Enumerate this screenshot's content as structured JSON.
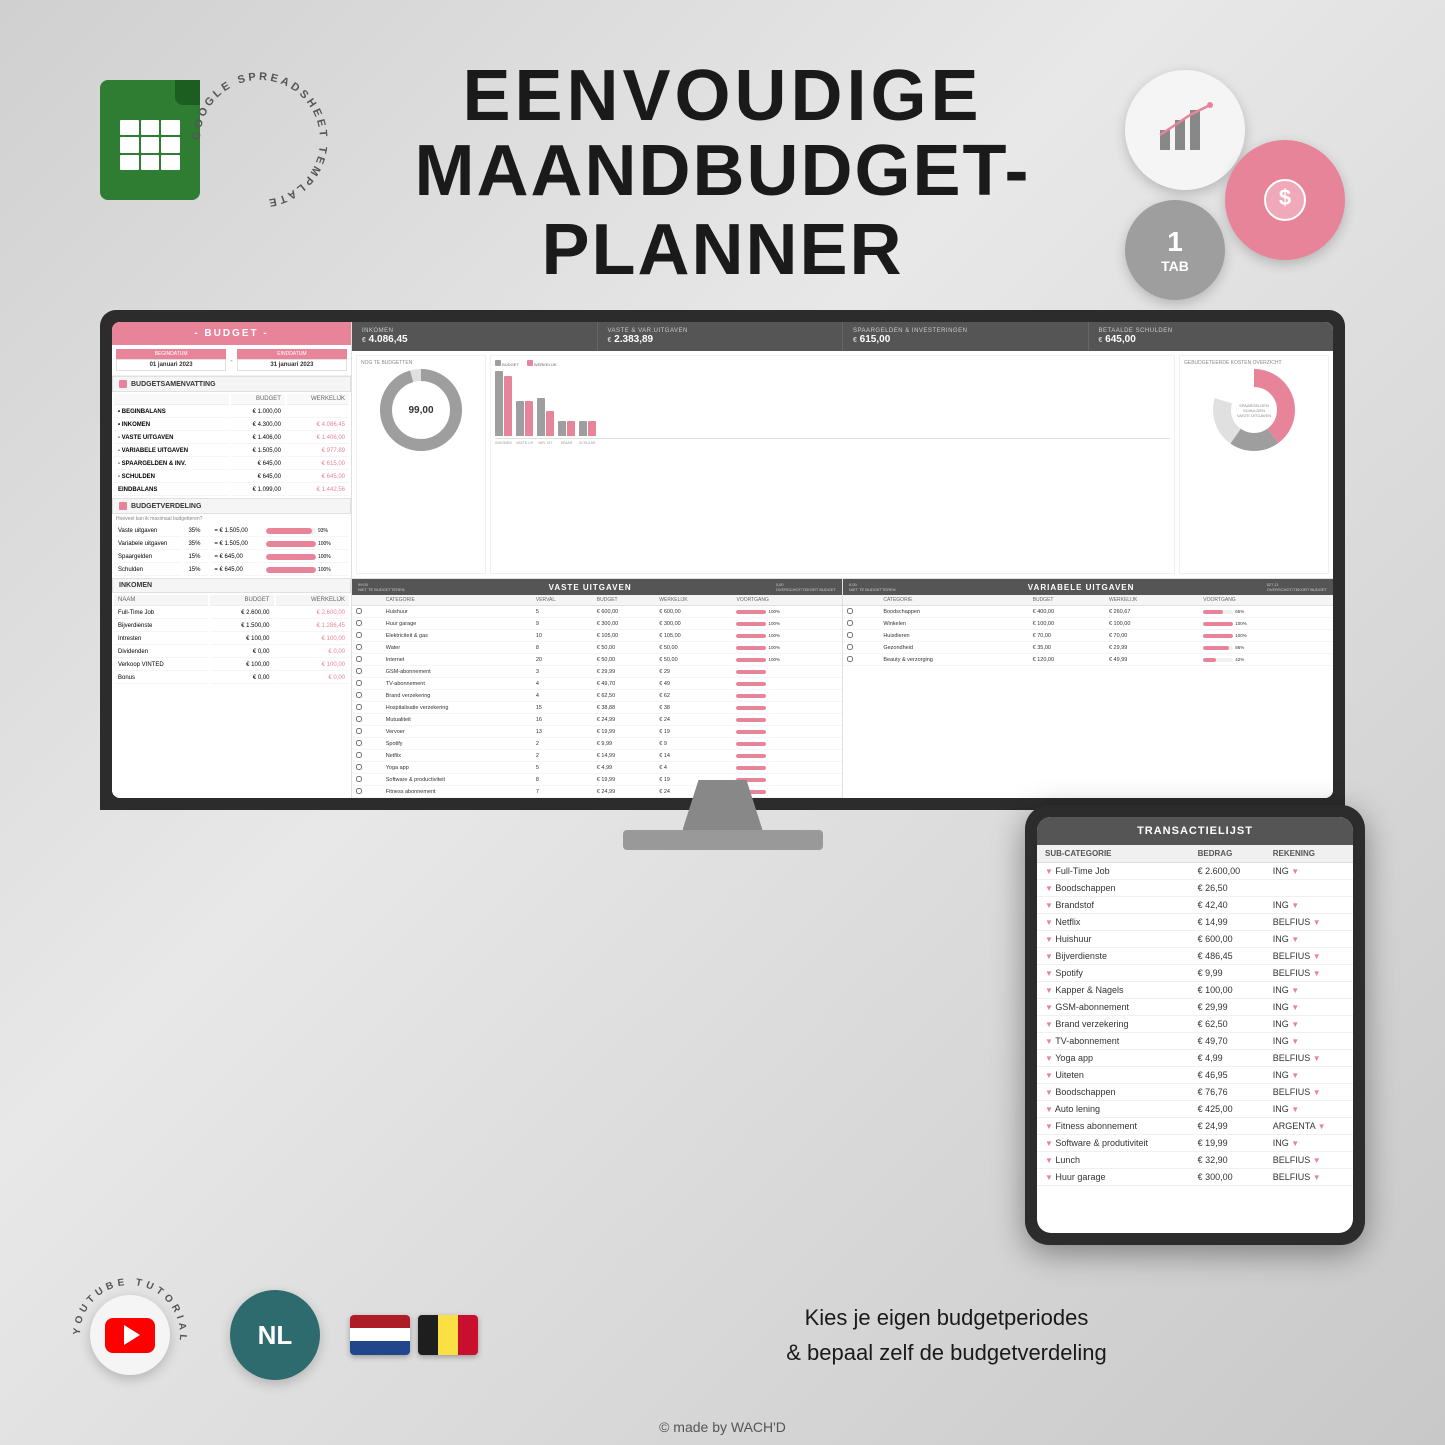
{
  "title": {
    "line1": "EENVOUDIGE",
    "line2": "MAANDBUDGET-PLANNER"
  },
  "badges": {
    "tab_number": "1",
    "tab_label": "TAB"
  },
  "circular_text": "GOOGLE SPREADSHEET TEMPLATE",
  "spreadsheet": {
    "header": "- BUDGET -",
    "start_date": "01 januari 2023",
    "end_date": "31 januari 2023",
    "start_label": "BEGINDATUM",
    "end_label": "EINDDATUM",
    "samenvatting_title": "BUDGETSAMENVATTING",
    "verdeling_title": "BUDGETVERDELING",
    "inkomen_title": "INKOMEN",
    "summary_rows": [
      {
        "label": "• BEGINBALANS",
        "budget": "€ 1.000,00",
        "werkelijk": ""
      },
      {
        "label": "• INKOMEN",
        "budget": "€ 4.300,00",
        "werkelijk": "€ 4.086,45"
      },
      {
        "label": "- VASTE UITGAVEN",
        "budget": "€ 1.406,00",
        "werkelijk": "€ 1.406,00"
      },
      {
        "label": "- VARIABELE UITGAVEN",
        "budget": "€ 1.505,00",
        "werkelijk": "€ 977,89"
      },
      {
        "label": "- SPAARGELDEN & INV.",
        "budget": "€ 645,00",
        "werkelijk": "€ 615,00"
      },
      {
        "label": "- SCHULDEN",
        "budget": "€ 645,00",
        "werkelijk": "€ 645,00"
      },
      {
        "label": "EINDBALANS",
        "budget": "€ 1.099,00",
        "werkelijk": "€ 1.442,56"
      }
    ],
    "verdeling_rows": [
      {
        "label": "Vaste uitgaven",
        "pct": "35%",
        "budget": "€ 1.505,00",
        "werkelijk": "93%"
      },
      {
        "label": "Variabele uitgaven",
        "pct": "35%",
        "budget": "€ 1.505,00",
        "werkelijk": "100%"
      },
      {
        "label": "Spaargelden",
        "pct": "15%",
        "budget": "€ 645,00",
        "werkelijk": "100%"
      },
      {
        "label": "Schulden",
        "pct": "15%",
        "budget": "€ 645,00",
        "werkelijk": "100%"
      }
    ],
    "inkomen_rows": [
      {
        "naam": "Full-Time Job",
        "budget": "€ 2.600,00",
        "werkelijk": "€ 2.600,00"
      },
      {
        "naam": "Bijverdienste",
        "budget": "€ 1.500,00",
        "werkelijk": "€ 1.286,45"
      },
      {
        "naam": "Intresten",
        "budget": "€ 100,00",
        "werkelijk": "€ 100,00"
      },
      {
        "naam": "Dividenden",
        "budget": "€ 0,00",
        "werkelijk": "€ 0,00"
      },
      {
        "naam": "Verkoop VINTED",
        "budget": "€ 100,00",
        "werkelijk": "€ 100,00"
      },
      {
        "naam": "Bonus",
        "budget": "€ 0,00",
        "werkelijk": "€ 0,00"
      }
    ],
    "stats": [
      {
        "label": "INKOMEN",
        "currency": "€",
        "value": "4.086,45"
      },
      {
        "label": "VASTE & VAR.UITGAVEN",
        "currency": "€",
        "value": "2.383,89"
      },
      {
        "label": "SPAARGELDEN & INVESTERINGEN",
        "currency": "€",
        "value": "615,00"
      },
      {
        "label": "BETAALDE SCHULDEN",
        "currency": "€",
        "value": "645,00"
      }
    ],
    "nog_te_budgetten": "NOG TE BUDGETTEN",
    "donut_value": "99,00",
    "gebudgeteerde_kosten": "GEBUDGETEERDE KOSTEN OVERZICHT",
    "bar_legend_budget": "BUDGET",
    "bar_legend_werkelijk": "WERKELIJK",
    "bar_labels": [
      "INKOMEN",
      "VASTE UITGAVEN",
      "VARIABELE UITGAVEN",
      "SPAARGELDEN",
      "SCHULDEN"
    ],
    "vaste_uitgaven_title": "VASTE UITGAVEN",
    "variabele_uitgaven_title": "VARIABELE UITGAVEN",
    "vaste_rows": [
      {
        "cat": "Huishuur",
        "verval": "5",
        "budget": "600,00",
        "werkelijk": "600,00",
        "voortgang": "100%"
      },
      {
        "cat": "Huur garage",
        "verval": "9",
        "budget": "300,00",
        "werkelijk": "300,00",
        "voortgang": "100%"
      },
      {
        "cat": "Elektriciteit & gas",
        "verval": "10",
        "budget": "105,00",
        "werkelijk": "105,00",
        "voortgang": "100%"
      },
      {
        "cat": "Water",
        "verval": "8",
        "budget": "50,00",
        "werkelijk": "50,00",
        "voortgang": "100%"
      },
      {
        "cat": "Internet",
        "verval": "20",
        "budget": "50,00",
        "werkelijk": "50,00",
        "voortgang": "100%"
      },
      {
        "cat": "GSM-abonnement",
        "verval": "3",
        "budget": "29,99",
        "werkelijk": "29",
        "voortgang": ""
      },
      {
        "cat": "TV-abonnement",
        "verval": "4",
        "budget": "49,70",
        "werkelijk": "49",
        "voortgang": ""
      },
      {
        "cat": "Brand verzekering",
        "verval": "4",
        "budget": "62,50",
        "werkelijk": "62",
        "voortgang": ""
      },
      {
        "cat": "Hospitalisatie verzekering",
        "verval": "15",
        "budget": "38,88",
        "werkelijk": "38",
        "voortgang": ""
      },
      {
        "cat": "Mutualiteit",
        "verval": "16",
        "budget": "24,99",
        "werkelijk": "24",
        "voortgang": ""
      },
      {
        "cat": "Vervoer",
        "verval": "13",
        "budget": "19,99",
        "werkelijk": "19",
        "voortgang": ""
      },
      {
        "cat": "Spotify",
        "verval": "2",
        "budget": "9,99",
        "werkelijk": "9",
        "voortgang": ""
      },
      {
        "cat": "Netflix",
        "verval": "2",
        "budget": "14,99",
        "werkelijk": "14",
        "voortgang": ""
      },
      {
        "cat": "Yoga app",
        "verval": "5",
        "budget": "4,99",
        "werkelijk": "4",
        "voortgang": ""
      },
      {
        "cat": "Software & productiviteit",
        "verval": "8",
        "budget": "19,99",
        "werkelijk": "19",
        "voortgang": ""
      },
      {
        "cat": "Fitness abonnement",
        "verval": "7",
        "budget": "24,99",
        "werkelijk": "24",
        "voortgang": ""
      }
    ],
    "variabele_rows": [
      {
        "cat": "Boodschappen",
        "budget": "400,00",
        "werkelijk": "260,67",
        "voortgang": "65%"
      },
      {
        "cat": "Winkelen",
        "budget": "100,00",
        "werkelijk": "100,00",
        "voortgang": "100%"
      },
      {
        "cat": "Huisdieren",
        "budget": "70,00",
        "werkelijk": "70,00",
        "voortgang": "100%"
      },
      {
        "cat": "Gezondheid",
        "budget": "35,00",
        "werkelijk": "29,99",
        "voortgang": "86%"
      },
      {
        "cat": "Beauty & verzorging",
        "budget": "120,00",
        "werkelijk": "49,99",
        "voortgang": "42%"
      }
    ]
  },
  "tablet": {
    "title": "TRANSACTIELIJST",
    "col1": "SUB-CATEGORIE",
    "col2": "BEDRAG",
    "col3": "REKENING",
    "rows": [
      {
        "cat": "Full-Time Job",
        "bedrag": "€ 2.600,00",
        "rekening": "ING"
      },
      {
        "cat": "Boodschappen",
        "bedrag": "€ 26,50",
        "rekening": ""
      },
      {
        "cat": "Brandstof",
        "bedrag": "€ 42,40",
        "rekening": "ING"
      },
      {
        "cat": "Netflix",
        "bedrag": "€ 14,99",
        "rekening": "BELFIUS"
      },
      {
        "cat": "Huishuur",
        "bedrag": "€ 600,00",
        "rekening": "ING"
      },
      {
        "cat": "Bijverdienste",
        "bedrag": "€ 486,45",
        "rekening": "BELFIUS"
      },
      {
        "cat": "Spotify",
        "bedrag": "€ 9,99",
        "rekening": "BELFIUS"
      },
      {
        "cat": "Kapper & Nagels",
        "bedrag": "€ 100,00",
        "rekening": "ING"
      },
      {
        "cat": "GSM-abonnement",
        "bedrag": "€ 29,99",
        "rekening": "ING"
      },
      {
        "cat": "Brand verzekering",
        "bedrag": "€ 62,50",
        "rekening": "ING"
      },
      {
        "cat": "TV-abonnement",
        "bedrag": "€ 49,70",
        "rekening": "ING"
      },
      {
        "cat": "Yoga app",
        "bedrag": "€ 4,99",
        "rekening": "BELFIUS"
      },
      {
        "cat": "Uiteten",
        "bedrag": "€ 46,95",
        "rekening": "ING"
      },
      {
        "cat": "Boodschappen",
        "bedrag": "€ 76,76",
        "rekening": "BELFIUS"
      },
      {
        "cat": "Auto lening",
        "bedrag": "€ 425,00",
        "rekening": "ING"
      },
      {
        "cat": "Fitness abonnement",
        "bedrag": "€ 24,99",
        "rekening": "ARGENTA"
      },
      {
        "cat": "Software & produtiviteit",
        "bedrag": "€ 19,99",
        "rekening": "ING"
      },
      {
        "cat": "Lunch",
        "bedrag": "€ 32,90",
        "rekening": "BELFIUS"
      },
      {
        "cat": "Huur garage",
        "bedrag": "€ 300,00",
        "rekening": "BELFIUS"
      }
    ]
  },
  "bottom": {
    "text_line1": "Kies je eigen budgetperiodes",
    "text_line2": "& bepaal zelf de budgetverdeling",
    "youtube_label": "YOUTUBE TUTORIAL",
    "nl_label": "NL",
    "copyright": "© made by WACH'D"
  },
  "colors": {
    "pink": "#e8849a",
    "dark": "#555555",
    "green": "#2e7d32",
    "teal": "#2e6b6e"
  }
}
